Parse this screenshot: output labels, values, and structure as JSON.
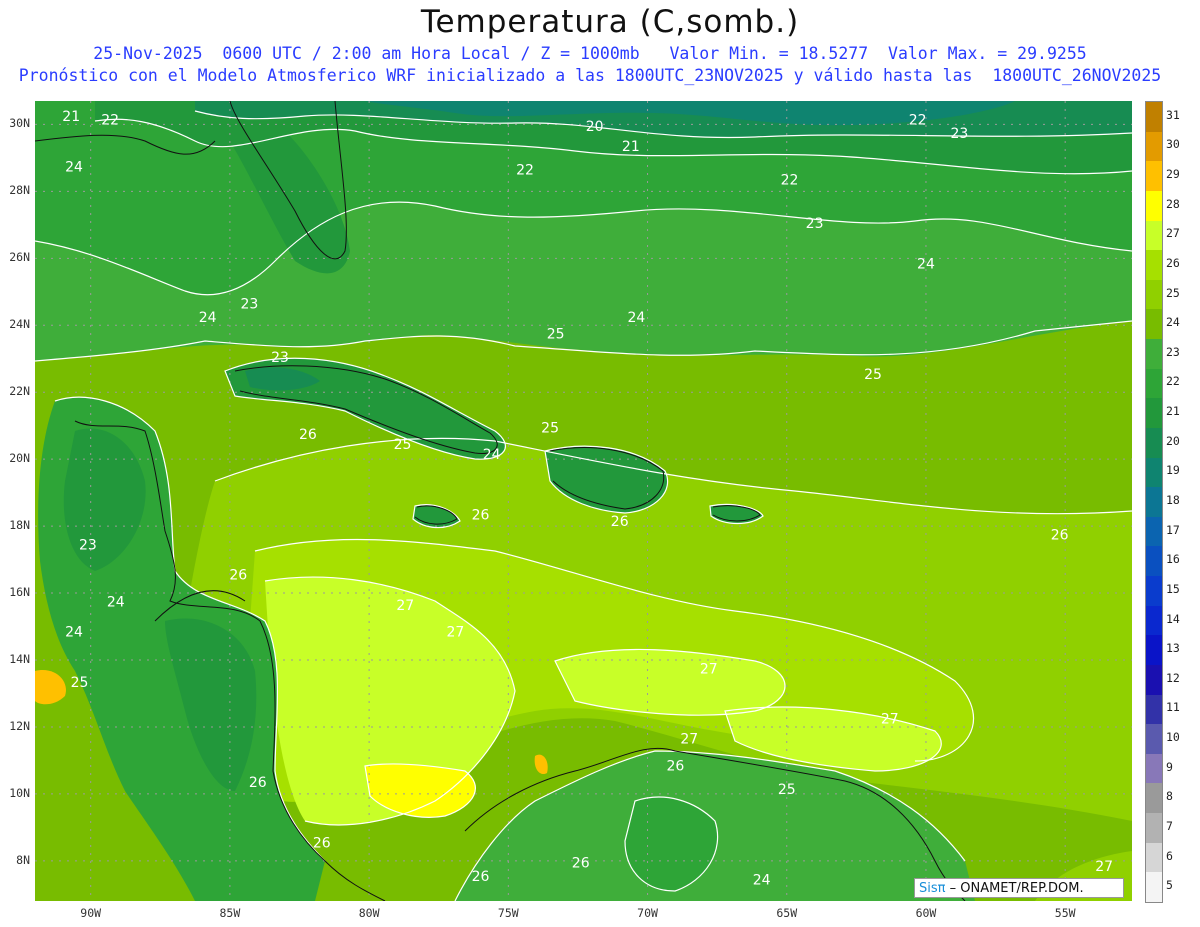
{
  "header": {
    "title": "Temperatura (C,somb.)",
    "line1": "25-Nov-2025  0600 UTC / 2:00 am Hora Local / Z = 1000mb   Valor Min. = 18.5277  Valor Max. = 29.9255",
    "line2": "Pronóstico con el Modelo Atmosferico WRF inicializado a las 1800UTC_23NOV2025 y válido hasta las  1800UTC_26NOV2025"
  },
  "map": {
    "lat_labels": [
      "30N",
      "28N",
      "26N",
      "24N",
      "22N",
      "20N",
      "18N",
      "16N",
      "14N",
      "12N",
      "10N",
      "8N"
    ],
    "lon_labels": [
      "90W",
      "85W",
      "80W",
      "75W",
      "70W",
      "65W",
      "60W",
      "55W"
    ],
    "lon_range": [
      -92,
      -52.6
    ],
    "lat_range": [
      6.8,
      30.7
    ],
    "contour_labels": [
      {
        "text": "21",
        "lon": -90.7,
        "lat": 30.1
      },
      {
        "text": "22",
        "lon": -89.3,
        "lat": 30.0
      },
      {
        "text": "24",
        "lon": -90.6,
        "lat": 28.6
      },
      {
        "text": "20",
        "lon": -71.9,
        "lat": 29.8
      },
      {
        "text": "21",
        "lon": -70.6,
        "lat": 29.2
      },
      {
        "text": "22",
        "lon": -60.3,
        "lat": 30.0
      },
      {
        "text": "23",
        "lon": -58.8,
        "lat": 29.6
      },
      {
        "text": "22",
        "lon": -74.4,
        "lat": 28.5
      },
      {
        "text": "22",
        "lon": -64.9,
        "lat": 28.2
      },
      {
        "text": "23",
        "lon": -64.0,
        "lat": 26.9
      },
      {
        "text": "24",
        "lon": -60.0,
        "lat": 25.7
      },
      {
        "text": "23",
        "lon": -84.3,
        "lat": 24.5
      },
      {
        "text": "24",
        "lon": -85.8,
        "lat": 24.1
      },
      {
        "text": "24",
        "lon": -70.4,
        "lat": 24.1
      },
      {
        "text": "25",
        "lon": -73.3,
        "lat": 23.6
      },
      {
        "text": "23",
        "lon": -83.2,
        "lat": 22.9
      },
      {
        "text": "25",
        "lon": -61.9,
        "lat": 22.4
      },
      {
        "text": "26",
        "lon": -82.2,
        "lat": 20.6
      },
      {
        "text": "25",
        "lon": -78.8,
        "lat": 20.3
      },
      {
        "text": "24",
        "lon": -75.6,
        "lat": 20.0
      },
      {
        "text": "25",
        "lon": -73.5,
        "lat": 20.8
      },
      {
        "text": "26",
        "lon": -76.0,
        "lat": 18.2
      },
      {
        "text": "26",
        "lon": -71.0,
        "lat": 18.0
      },
      {
        "text": "26",
        "lon": -55.2,
        "lat": 17.6
      },
      {
        "text": "23",
        "lon": -90.1,
        "lat": 17.3
      },
      {
        "text": "26",
        "lon": -84.7,
        "lat": 16.4
      },
      {
        "text": "24",
        "lon": -89.1,
        "lat": 15.6
      },
      {
        "text": "27",
        "lon": -78.7,
        "lat": 15.5
      },
      {
        "text": "24",
        "lon": -90.6,
        "lat": 14.7
      },
      {
        "text": "27",
        "lon": -76.9,
        "lat": 14.7
      },
      {
        "text": "27",
        "lon": -67.8,
        "lat": 13.6
      },
      {
        "text": "25",
        "lon": -90.4,
        "lat": 13.2
      },
      {
        "text": "27",
        "lon": -61.3,
        "lat": 12.1
      },
      {
        "text": "27",
        "lon": -68.5,
        "lat": 11.5
      },
      {
        "text": "26",
        "lon": -69.0,
        "lat": 10.7
      },
      {
        "text": "25",
        "lon": -65.0,
        "lat": 10.0
      },
      {
        "text": "26",
        "lon": -84.0,
        "lat": 10.2
      },
      {
        "text": "26",
        "lon": -81.7,
        "lat": 8.4
      },
      {
        "text": "26",
        "lon": -76.0,
        "lat": 7.4
      },
      {
        "text": "26",
        "lon": -72.4,
        "lat": 7.8
      },
      {
        "text": "24",
        "lon": -65.9,
        "lat": 7.3
      },
      {
        "text": "27",
        "lon": -53.6,
        "lat": 7.7
      }
    ]
  },
  "colorbar": {
    "levels": [
      "31",
      "30",
      "29",
      "28",
      "27",
      "26",
      "25",
      "24",
      "23",
      "22",
      "21",
      "20",
      "19",
      "18",
      "17",
      "16",
      "15",
      "14",
      "13",
      "12",
      "11",
      "10",
      "9",
      "8",
      "7",
      "6",
      "5"
    ],
    "colors": [
      "#c08000",
      "#e39b00",
      "#ffc000",
      "#ffff00",
      "#c8ff28",
      "#a6e000",
      "#90d000",
      "#78bc00",
      "#3fae3a",
      "#2ea537",
      "#22983b",
      "#178c52",
      "#0f8470",
      "#0c7694",
      "#0b64b0",
      "#0a50c0",
      "#0a3ccd",
      "#0a28cf",
      "#0a14c8",
      "#1a10b0",
      "#3232a8",
      "#5a5aae",
      "#8878b8",
      "#9a9a9a",
      "#b2b2b2",
      "#d6d6d6",
      "#f4f4f4"
    ]
  },
  "credit": {
    "sis": "Sisπ",
    "org": " – ONAMET/REP.DOM."
  }
}
